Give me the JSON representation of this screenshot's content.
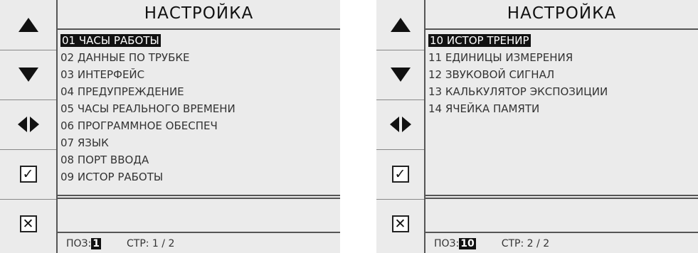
{
  "left": {
    "title": "НАСТРОЙКА",
    "items": [
      "01 ЧАСЫ РАБОТЫ",
      "02 ДАННЫЕ ПО ТРУБКЕ",
      "03 ИНТЕРФЕЙС",
      "04 ПРЕДУПРЕЖДЕНИЕ",
      "05 ЧАСЫ РЕАЛЬНОГО ВРЕМЕНИ",
      "06 ПРОГРАММНОЕ ОБЕСПЕЧ",
      "07 ЯЗЫК",
      "08 ПОРТ ВВОДА",
      "09 ИСТОР РАБОТЫ"
    ],
    "selected_index": 0,
    "footer": {
      "poz_label": "ПОЗ:",
      "poz_value": "1",
      "page_label": "СТР: 1 / 2"
    }
  },
  "right": {
    "title": "НАСТРОЙКА",
    "items": [
      "10 ИСТОР ТРЕНИР",
      "11 ЕДИНИЦЫ ИЗМЕРЕНИЯ",
      "12 ЗВУКОВОЙ СИГНАЛ",
      "13 КАЛЬКУЛЯТОР ЭКСПОЗИЦИИ",
      "14 ЯЧЕЙКА ПАМЯТИ"
    ],
    "selected_index": 0,
    "footer": {
      "poz_label": "ПОЗ:",
      "poz_value": "10",
      "page_label": "СТР: 2 / 2"
    }
  },
  "icons": {
    "up": "arrow-up-icon",
    "down": "arrow-down-icon",
    "leftright": "arrow-left-right-icon",
    "confirm": "checkmark-icon",
    "cancel": "close-icon"
  },
  "glyphs": {
    "check": "✓",
    "cross": "✕"
  }
}
